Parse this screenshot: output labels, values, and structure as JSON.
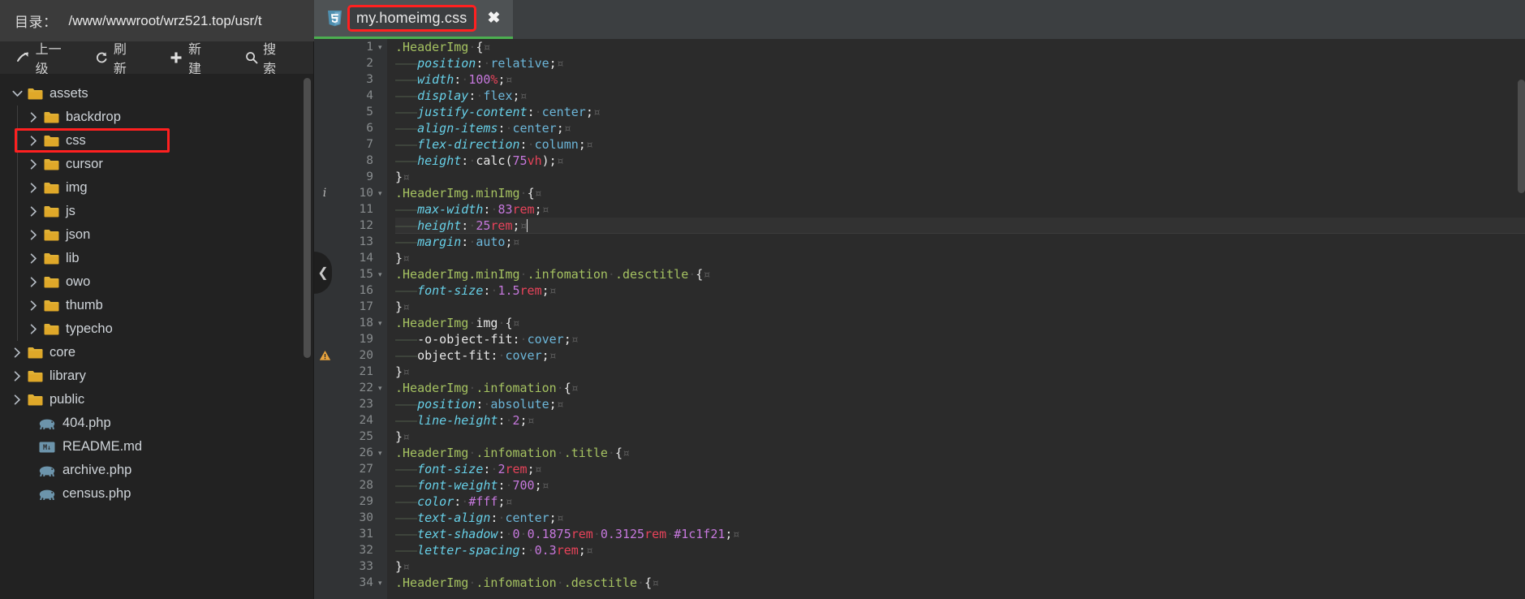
{
  "file_manager": {
    "path_label": "目录：",
    "path_value": "/www/wwwroot/wrz521.top/usr/t",
    "toolbar": {
      "up_label": "上一级",
      "refresh_label": "刷新",
      "new_label": "新建",
      "search_label": "搜索"
    },
    "tree": [
      {
        "name": "assets",
        "type": "folder",
        "depth": 0,
        "state": "expanded",
        "highlighted": false
      },
      {
        "name": "backdrop",
        "type": "folder",
        "depth": 1,
        "state": "collapsed",
        "highlighted": false
      },
      {
        "name": "css",
        "type": "folder",
        "depth": 1,
        "state": "collapsed",
        "highlighted": true
      },
      {
        "name": "cursor",
        "type": "folder",
        "depth": 1,
        "state": "collapsed",
        "highlighted": false
      },
      {
        "name": "img",
        "type": "folder",
        "depth": 1,
        "state": "collapsed",
        "highlighted": false
      },
      {
        "name": "js",
        "type": "folder",
        "depth": 1,
        "state": "collapsed",
        "highlighted": false
      },
      {
        "name": "json",
        "type": "folder",
        "depth": 1,
        "state": "collapsed",
        "highlighted": false
      },
      {
        "name": "lib",
        "type": "folder",
        "depth": 1,
        "state": "collapsed",
        "highlighted": false
      },
      {
        "name": "owo",
        "type": "folder",
        "depth": 1,
        "state": "collapsed",
        "highlighted": false
      },
      {
        "name": "thumb",
        "type": "folder",
        "depth": 1,
        "state": "collapsed",
        "highlighted": false
      },
      {
        "name": "typecho",
        "type": "folder",
        "depth": 1,
        "state": "collapsed",
        "highlighted": false
      },
      {
        "name": "core",
        "type": "folder",
        "depth": 0,
        "state": "collapsed",
        "highlighted": false
      },
      {
        "name": "library",
        "type": "folder",
        "depth": 0,
        "state": "collapsed",
        "highlighted": false
      },
      {
        "name": "public",
        "type": "folder",
        "depth": 0,
        "state": "collapsed",
        "highlighted": false
      },
      {
        "name": "404.php",
        "type": "php",
        "depth": 1,
        "state": "file",
        "highlighted": false
      },
      {
        "name": "README.md",
        "type": "markdown",
        "depth": 1,
        "state": "file",
        "highlighted": false
      },
      {
        "name": "archive.php",
        "type": "php",
        "depth": 1,
        "state": "file",
        "highlighted": false
      },
      {
        "name": "census.php",
        "type": "php",
        "depth": 1,
        "state": "file",
        "highlighted": false
      }
    ]
  },
  "editor": {
    "tab": {
      "title": "my.homeimg.css",
      "icon": "css3-icon",
      "close_label": "✖",
      "highlighted": true,
      "active_underline_color": "#4caf50"
    },
    "highlight_color": "#ff2020",
    "current_line": 12,
    "gutter_marks": [
      {
        "line": 10,
        "type": "info",
        "glyph": "i"
      },
      {
        "line": 20,
        "type": "warning",
        "glyph": "⚠"
      }
    ],
    "collapse_handle_icon": "chevron-left-icon",
    "lines": [
      {
        "n": 1,
        "fold": true,
        "text": ".HeaderImg {"
      },
      {
        "n": 2,
        "fold": false,
        "text": "    position: relative;"
      },
      {
        "n": 3,
        "fold": false,
        "text": "    width: 100%;"
      },
      {
        "n": 4,
        "fold": false,
        "text": "    display: flex;"
      },
      {
        "n": 5,
        "fold": false,
        "text": "    justify-content: center;"
      },
      {
        "n": 6,
        "fold": false,
        "text": "    align-items: center;"
      },
      {
        "n": 7,
        "fold": false,
        "text": "    flex-direction: column;"
      },
      {
        "n": 8,
        "fold": false,
        "text": "    height: calc(75vh);"
      },
      {
        "n": 9,
        "fold": false,
        "text": "}"
      },
      {
        "n": 10,
        "fold": true,
        "text": ".HeaderImg.minImg {"
      },
      {
        "n": 11,
        "fold": false,
        "text": "    max-width: 83rem;"
      },
      {
        "n": 12,
        "fold": false,
        "text": "    height: 25rem;"
      },
      {
        "n": 13,
        "fold": false,
        "text": "    margin: auto;"
      },
      {
        "n": 14,
        "fold": false,
        "text": "}"
      },
      {
        "n": 15,
        "fold": true,
        "text": ".HeaderImg.minImg .infomation .desctitle {"
      },
      {
        "n": 16,
        "fold": false,
        "text": "    font-size: 1.5rem;"
      },
      {
        "n": 17,
        "fold": false,
        "text": "}"
      },
      {
        "n": 18,
        "fold": true,
        "text": ".HeaderImg img {"
      },
      {
        "n": 19,
        "fold": false,
        "text": "    -o-object-fit: cover;"
      },
      {
        "n": 20,
        "fold": false,
        "text": "    object-fit: cover;"
      },
      {
        "n": 21,
        "fold": false,
        "text": "}"
      },
      {
        "n": 22,
        "fold": true,
        "text": ".HeaderImg .infomation {"
      },
      {
        "n": 23,
        "fold": false,
        "text": "    position: absolute;"
      },
      {
        "n": 24,
        "fold": false,
        "text": "    line-height: 2;"
      },
      {
        "n": 25,
        "fold": false,
        "text": "}"
      },
      {
        "n": 26,
        "fold": true,
        "text": ".HeaderImg .infomation .title {"
      },
      {
        "n": 27,
        "fold": false,
        "text": "    font-size: 2rem;"
      },
      {
        "n": 28,
        "fold": false,
        "text": "    font-weight: 700;"
      },
      {
        "n": 29,
        "fold": false,
        "text": "    color: #fff;"
      },
      {
        "n": 30,
        "fold": false,
        "text": "    text-align: center;"
      },
      {
        "n": 31,
        "fold": false,
        "text": "    text-shadow: 0 0.1875rem 0.3125rem #1c1f21;"
      },
      {
        "n": 32,
        "fold": false,
        "text": "    letter-spacing: 0.3rem;"
      },
      {
        "n": 33,
        "fold": false,
        "text": "}"
      },
      {
        "n": 34,
        "fold": true,
        "text": ".HeaderImg .infomation .desctitle {"
      }
    ]
  }
}
